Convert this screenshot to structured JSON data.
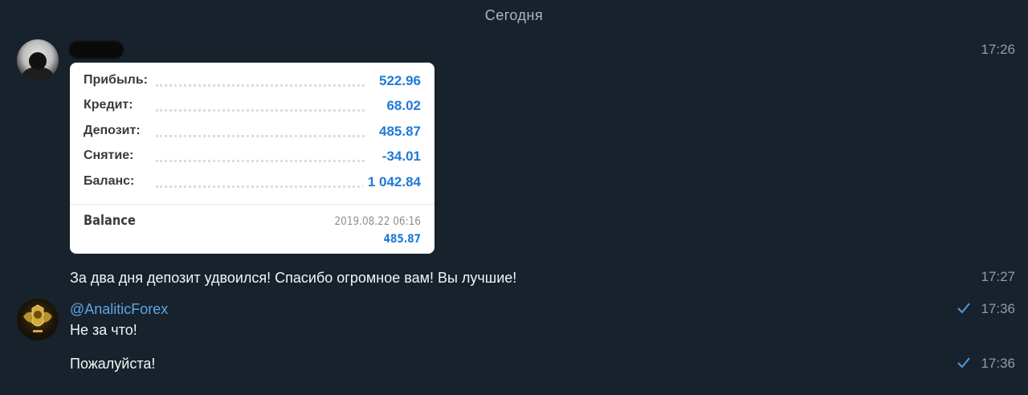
{
  "date_separator": "Сегодня",
  "messages": {
    "card_message": {
      "time": "17:26",
      "rows": [
        {
          "label": "Прибыль:",
          "value": "522.96"
        },
        {
          "label": "Кредит:",
          "value": "68.02"
        },
        {
          "label": "Депозит:",
          "value": "485.87"
        },
        {
          "label": "Снятие:",
          "value": "-34.01"
        },
        {
          "label": "Баланс:",
          "value": "1 042.84"
        }
      ],
      "balance_entry": {
        "label": "Balance",
        "date": "2019.08.22 06:16",
        "amount": "485.87"
      }
    },
    "text_message": {
      "text": "За два дня депозит удвоился! Спасибо огромное вам! Вы лучшие!",
      "time": "17:27"
    },
    "reply_1": {
      "sender": "@AnaliticForex",
      "text": "Не за что!",
      "time": "17:36"
    },
    "reply_2": {
      "text": "Пожалуйста!",
      "time": "17:36"
    }
  },
  "colors": {
    "background": "#18222d",
    "accent": "#1f7ad8",
    "sender_name": "#5aa7e8",
    "check": "#4c9ce2"
  },
  "icons": {
    "user_avatar": "user-avatar",
    "brand_avatar": "lion-crest-avatar",
    "sent_check": "check-icon"
  }
}
